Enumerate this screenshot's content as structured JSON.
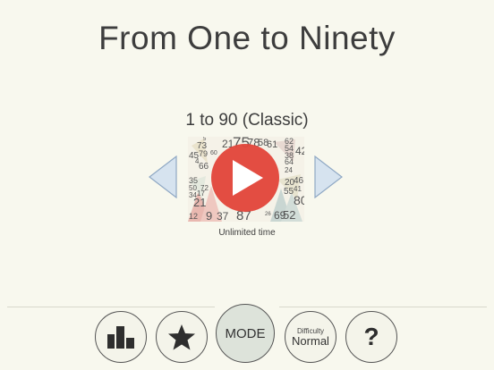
{
  "app": {
    "title": "From One to Ninety"
  },
  "mode_selector": {
    "title": "1 to 90 (Classic)",
    "subtitle": "Unlimited time",
    "prev_icon": "triangle-left-icon",
    "next_icon": "triangle-right-icon",
    "play_icon": "play-icon",
    "preview_numbers": [
      "5",
      "73",
      "21",
      "75",
      "78",
      "58",
      "61",
      "62",
      "54",
      "38",
      "64",
      "45",
      "79",
      "60",
      "24",
      "66",
      "42",
      "35",
      "50",
      "20",
      "46",
      "41",
      "34",
      "72",
      "55",
      "80",
      "21",
      "9",
      "37",
      "87",
      "69",
      "52",
      "12",
      "4",
      "17",
      "26"
    ]
  },
  "toolbar": {
    "stats_icon": "bar-chart-icon",
    "favorite_icon": "star-icon",
    "mode_label": "MODE",
    "difficulty_label": "Difficulty",
    "difficulty_value": "Normal",
    "help_label": "?"
  },
  "colors": {
    "background": "#f8f8ee",
    "arrow_fill": "#d6e3ef",
    "play_red": "#e2463b",
    "mode_button_fill": "#dde3da"
  }
}
